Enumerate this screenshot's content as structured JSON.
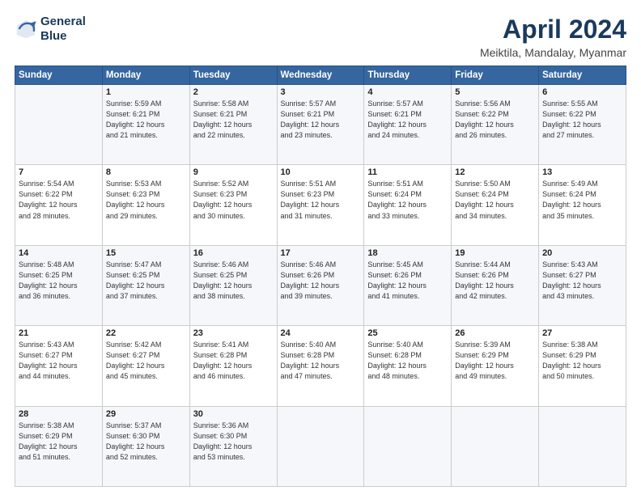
{
  "header": {
    "logo_line1": "General",
    "logo_line2": "Blue",
    "title": "April 2024",
    "subtitle": "Meiktila, Mandalay, Myanmar"
  },
  "weekdays": [
    "Sunday",
    "Monday",
    "Tuesday",
    "Wednesday",
    "Thursday",
    "Friday",
    "Saturday"
  ],
  "weeks": [
    [
      {
        "day": "",
        "info": ""
      },
      {
        "day": "1",
        "info": "Sunrise: 5:59 AM\nSunset: 6:21 PM\nDaylight: 12 hours\nand 21 minutes."
      },
      {
        "day": "2",
        "info": "Sunrise: 5:58 AM\nSunset: 6:21 PM\nDaylight: 12 hours\nand 22 minutes."
      },
      {
        "day": "3",
        "info": "Sunrise: 5:57 AM\nSunset: 6:21 PM\nDaylight: 12 hours\nand 23 minutes."
      },
      {
        "day": "4",
        "info": "Sunrise: 5:57 AM\nSunset: 6:21 PM\nDaylight: 12 hours\nand 24 minutes."
      },
      {
        "day": "5",
        "info": "Sunrise: 5:56 AM\nSunset: 6:22 PM\nDaylight: 12 hours\nand 26 minutes."
      },
      {
        "day": "6",
        "info": "Sunrise: 5:55 AM\nSunset: 6:22 PM\nDaylight: 12 hours\nand 27 minutes."
      }
    ],
    [
      {
        "day": "7",
        "info": "Sunrise: 5:54 AM\nSunset: 6:22 PM\nDaylight: 12 hours\nand 28 minutes."
      },
      {
        "day": "8",
        "info": "Sunrise: 5:53 AM\nSunset: 6:23 PM\nDaylight: 12 hours\nand 29 minutes."
      },
      {
        "day": "9",
        "info": "Sunrise: 5:52 AM\nSunset: 6:23 PM\nDaylight: 12 hours\nand 30 minutes."
      },
      {
        "day": "10",
        "info": "Sunrise: 5:51 AM\nSunset: 6:23 PM\nDaylight: 12 hours\nand 31 minutes."
      },
      {
        "day": "11",
        "info": "Sunrise: 5:51 AM\nSunset: 6:24 PM\nDaylight: 12 hours\nand 33 minutes."
      },
      {
        "day": "12",
        "info": "Sunrise: 5:50 AM\nSunset: 6:24 PM\nDaylight: 12 hours\nand 34 minutes."
      },
      {
        "day": "13",
        "info": "Sunrise: 5:49 AM\nSunset: 6:24 PM\nDaylight: 12 hours\nand 35 minutes."
      }
    ],
    [
      {
        "day": "14",
        "info": "Sunrise: 5:48 AM\nSunset: 6:25 PM\nDaylight: 12 hours\nand 36 minutes."
      },
      {
        "day": "15",
        "info": "Sunrise: 5:47 AM\nSunset: 6:25 PM\nDaylight: 12 hours\nand 37 minutes."
      },
      {
        "day": "16",
        "info": "Sunrise: 5:46 AM\nSunset: 6:25 PM\nDaylight: 12 hours\nand 38 minutes."
      },
      {
        "day": "17",
        "info": "Sunrise: 5:46 AM\nSunset: 6:26 PM\nDaylight: 12 hours\nand 39 minutes."
      },
      {
        "day": "18",
        "info": "Sunrise: 5:45 AM\nSunset: 6:26 PM\nDaylight: 12 hours\nand 41 minutes."
      },
      {
        "day": "19",
        "info": "Sunrise: 5:44 AM\nSunset: 6:26 PM\nDaylight: 12 hours\nand 42 minutes."
      },
      {
        "day": "20",
        "info": "Sunrise: 5:43 AM\nSunset: 6:27 PM\nDaylight: 12 hours\nand 43 minutes."
      }
    ],
    [
      {
        "day": "21",
        "info": "Sunrise: 5:43 AM\nSunset: 6:27 PM\nDaylight: 12 hours\nand 44 minutes."
      },
      {
        "day": "22",
        "info": "Sunrise: 5:42 AM\nSunset: 6:27 PM\nDaylight: 12 hours\nand 45 minutes."
      },
      {
        "day": "23",
        "info": "Sunrise: 5:41 AM\nSunset: 6:28 PM\nDaylight: 12 hours\nand 46 minutes."
      },
      {
        "day": "24",
        "info": "Sunrise: 5:40 AM\nSunset: 6:28 PM\nDaylight: 12 hours\nand 47 minutes."
      },
      {
        "day": "25",
        "info": "Sunrise: 5:40 AM\nSunset: 6:28 PM\nDaylight: 12 hours\nand 48 minutes."
      },
      {
        "day": "26",
        "info": "Sunrise: 5:39 AM\nSunset: 6:29 PM\nDaylight: 12 hours\nand 49 minutes."
      },
      {
        "day": "27",
        "info": "Sunrise: 5:38 AM\nSunset: 6:29 PM\nDaylight: 12 hours\nand 50 minutes."
      }
    ],
    [
      {
        "day": "28",
        "info": "Sunrise: 5:38 AM\nSunset: 6:29 PM\nDaylight: 12 hours\nand 51 minutes."
      },
      {
        "day": "29",
        "info": "Sunrise: 5:37 AM\nSunset: 6:30 PM\nDaylight: 12 hours\nand 52 minutes."
      },
      {
        "day": "30",
        "info": "Sunrise: 5:36 AM\nSunset: 6:30 PM\nDaylight: 12 hours\nand 53 minutes."
      },
      {
        "day": "",
        "info": ""
      },
      {
        "day": "",
        "info": ""
      },
      {
        "day": "",
        "info": ""
      },
      {
        "day": "",
        "info": ""
      }
    ]
  ]
}
